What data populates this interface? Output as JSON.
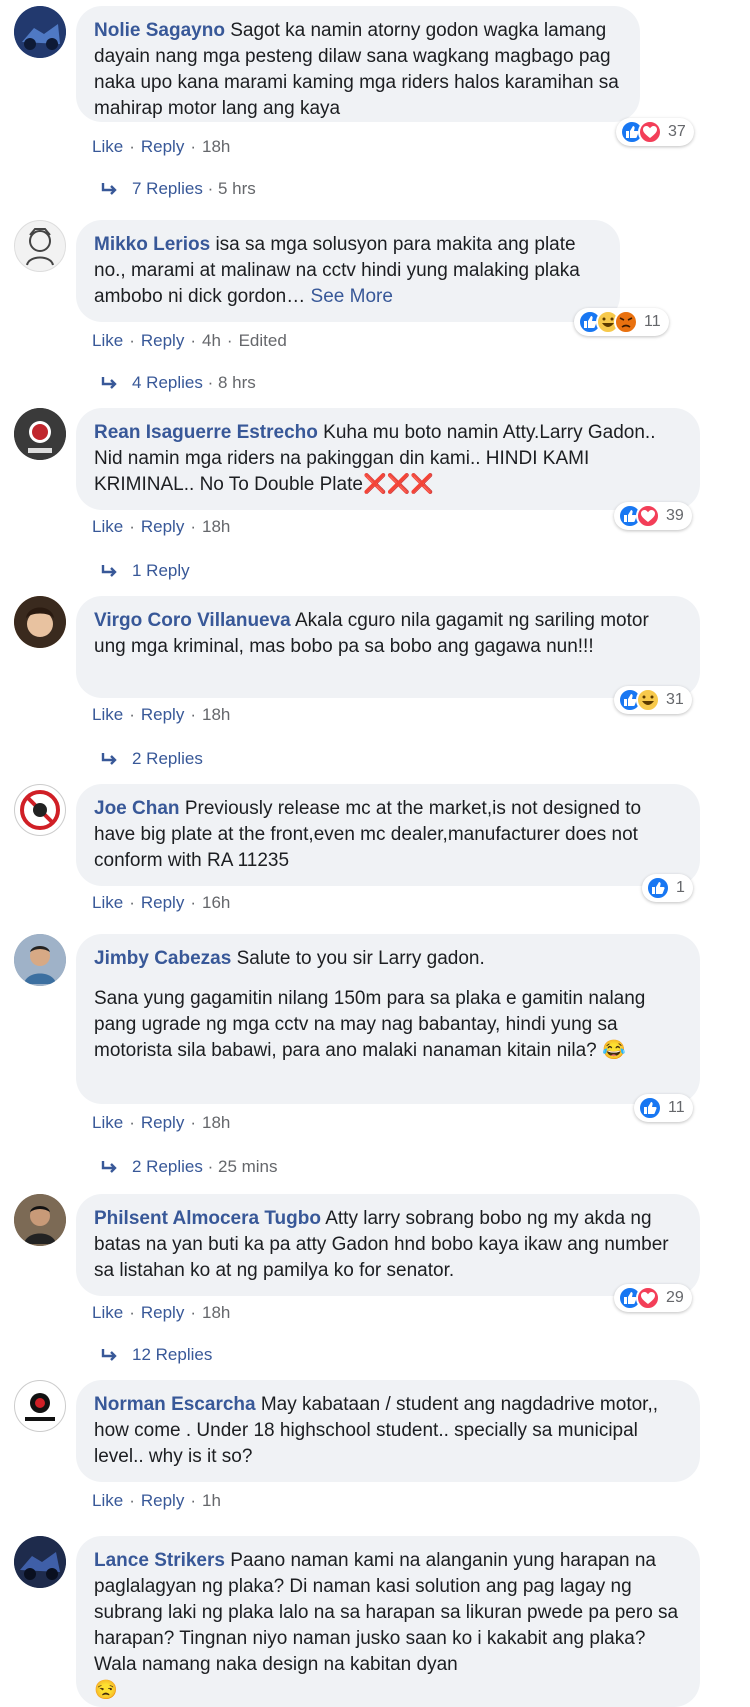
{
  "labels": {
    "like": "Like",
    "reply": "Reply",
    "dot": "·"
  },
  "colors": {
    "link": "#385898",
    "bubble": "#f0f2f5",
    "meta": "#65676b",
    "like_blue": "#1877f2",
    "love_red": "#f33e58",
    "haha_yellow": "#f7c94b",
    "angry_orange": "#e9710f"
  },
  "comments": [
    {
      "author": "Nolie Sagayno",
      "text": "Sagot ka namin atorny godon wagka lamang dayain nang mga pesteng dilaw sana wagkang magbago pag naka upo kana marami kaming mga riders halos karamihan sa mahirap motor lang ang kaya",
      "time": "18h",
      "reactions": {
        "icons": [
          "like",
          "love"
        ],
        "count": "37"
      },
      "replies": {
        "label": "7 Replies",
        "time": "5 hrs"
      }
    },
    {
      "author": "Mikko Lerios",
      "text": "isa sa mga solusyon para makita ang plate no., marami at malinaw na cctv hindi yung malaking plaka ambobo ni dick gordon…",
      "see_more": "See More",
      "time": "4h",
      "edited": "Edited",
      "reactions": {
        "icons": [
          "like",
          "haha",
          "angry"
        ],
        "count": "11"
      },
      "replies": {
        "label": "4 Replies",
        "time": "8 hrs"
      }
    },
    {
      "author": "Rean Isaguerre Estrecho",
      "text": "Kuha mu boto namin Atty.Larry Gadon.. Nid namin mga riders na pakinggan din kami.. HINDI KAMI KRIMINAL.. No To Double Plate",
      "emoji": "❌❌❌",
      "time": "18h",
      "reactions": {
        "icons": [
          "like",
          "love"
        ],
        "count": "39"
      },
      "replies": {
        "label": "1 Reply",
        "time": ""
      }
    },
    {
      "author": "Virgo Coro Villanueva",
      "text": "Akala cguro nila gagamit ng sariling motor ung mga kriminal, mas bobo pa sa bobo ang gagawa nun!!!",
      "time": "18h",
      "reactions": {
        "icons": [
          "like",
          "haha"
        ],
        "count": "31"
      },
      "replies": {
        "label": "2 Replies",
        "time": ""
      }
    },
    {
      "author": "Joe Chan",
      "text": "Previously release mc at the market,is not designed to have big plate at the front,even mc dealer,manufacturer does not conform with RA 11235",
      "time": "16h",
      "reactions": {
        "icons": [
          "like"
        ],
        "count": "1"
      }
    },
    {
      "author": "Jimby Cabezas",
      "text": "Salute to you sir Larry gadon.",
      "text2": "Sana yung gagamitin nilang 150m para sa plaka e gamitin nalang pang ugrade ng mga cctv na may nag babantay, hindi yung sa motorista sila babawi, para ano malaki nanaman kitain nila?",
      "emoji": "😂",
      "time": "18h",
      "reactions": {
        "icons": [
          "like"
        ],
        "count": "11"
      },
      "replies": {
        "label": "2 Replies",
        "time": "25 mins"
      }
    },
    {
      "author": "Philsent Almocera Tugbo",
      "text": "Atty larry sobrang bobo ng my akda ng batas na yan buti ka pa atty Gadon hnd bobo kaya ikaw ang number sa listahan ko at ng pamilya ko for senator.",
      "time": "18h",
      "reactions": {
        "icons": [
          "like",
          "love"
        ],
        "count": "29"
      },
      "replies": {
        "label": "12 Replies",
        "time": ""
      }
    },
    {
      "author": "Norman Escarcha",
      "text": "May kabataan / student ang nagdadrive motor,, how come . Under 18 highschool student.. specially sa municipal level.. why is it so?",
      "time": "1h"
    },
    {
      "author": "Lance Strikers",
      "text": "Paano naman kami na alanganin yung harapan na paglalagyan ng plaka? Di naman kasi solution ang pag lagay ng subrang laki ng plaka lalo na sa harapan sa likuran pwede pa pero sa harapan? Tingnan niyo naman jusko saan ko i kakabit ang plaka? Wala namang naka design na kabitan dyan",
      "emoji": "😒"
    }
  ]
}
